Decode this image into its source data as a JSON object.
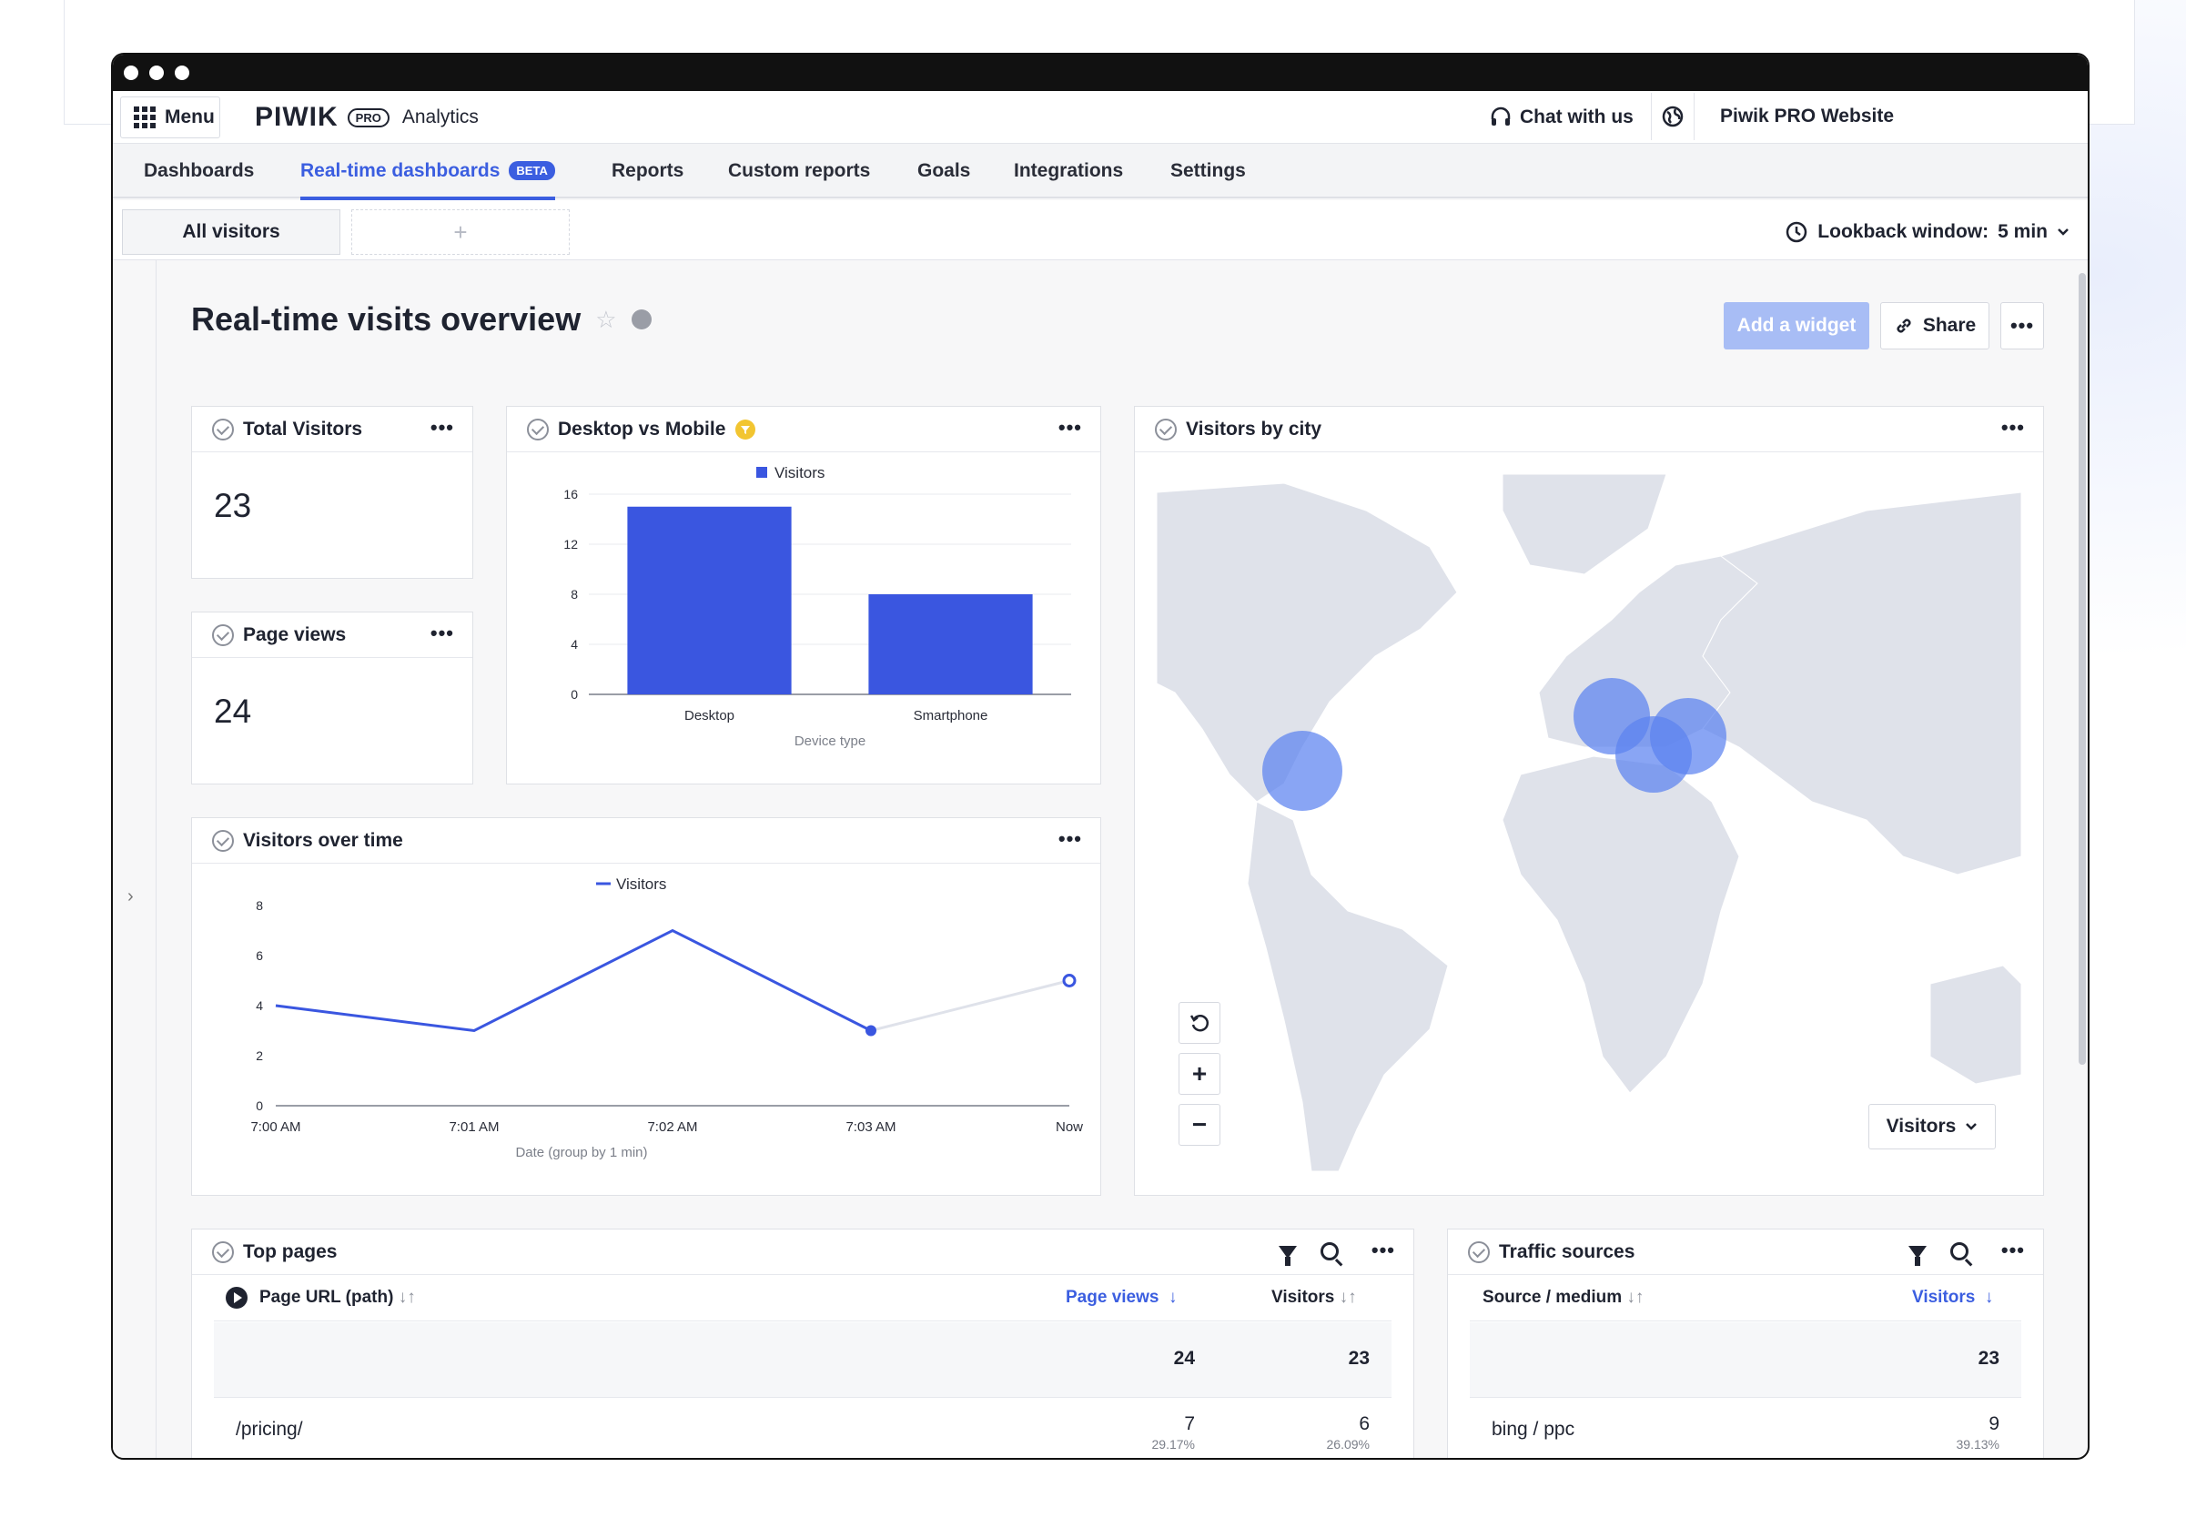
{
  "app": {
    "menu_label": "Menu",
    "logo_text": "PIWIK",
    "logo_badge": "PRO",
    "product": "Analytics",
    "chat_label": "Chat with us",
    "site_name": "Piwik PRO Website"
  },
  "nav": {
    "items": [
      {
        "label": "Dashboards"
      },
      {
        "label": "Real-time dashboards",
        "badge": "BETA",
        "active": true
      },
      {
        "label": "Reports"
      },
      {
        "label": "Custom reports"
      },
      {
        "label": "Goals"
      },
      {
        "label": "Integrations"
      },
      {
        "label": "Settings"
      }
    ]
  },
  "subbar": {
    "tab_label": "All visitors",
    "add_tab": "+",
    "lookback_label": "Lookback window:",
    "lookback_value": "5 min"
  },
  "page": {
    "title": "Real-time visits overview",
    "add_widget": "Add a widget",
    "share": "Share"
  },
  "widgets": {
    "total_visitors": {
      "title": "Total Visitors",
      "value": "23"
    },
    "page_views": {
      "title": "Page views",
      "value": "24"
    },
    "desktop_mobile": {
      "title": "Desktop vs Mobile"
    },
    "visitors_over_time": {
      "title": "Visitors over time"
    },
    "visitors_by_city": {
      "title": "Visitors by city",
      "metric_select": "Visitors"
    },
    "top_pages": {
      "title": "Top pages",
      "col_url": "Page URL (path)",
      "col_pageviews": "Page views",
      "col_visitors": "Visitors",
      "total_pageviews": "24",
      "total_visitors": "23",
      "rows": [
        {
          "url": "/pricing/",
          "pageviews": "7",
          "pageviews_pct": "29.17%",
          "visitors": "6",
          "visitors_pct": "26.09%"
        }
      ]
    },
    "traffic_sources": {
      "title": "Traffic sources",
      "col_source": "Source / medium",
      "col_visitors": "Visitors",
      "total_visitors": "23",
      "rows": [
        {
          "source": "bing / ppc",
          "visitors": "9",
          "visitors_pct": "39.13%"
        }
      ]
    }
  },
  "colors": {
    "accent": "#3b5ee0",
    "bar": "#3a56e0",
    "bubble": "#5b82f0",
    "map_land": "#ffffff",
    "map_sea": "#e3e6ee"
  },
  "chart_data": [
    {
      "type": "bar",
      "legend": [
        "Visitors"
      ],
      "categories": [
        "Desktop",
        "Smartphone"
      ],
      "values": [
        15,
        8
      ],
      "xlabel": "Device type",
      "ylabel": "",
      "ylim": [
        0,
        16
      ],
      "yticks": [
        0,
        4,
        8,
        12,
        16
      ]
    },
    {
      "type": "line",
      "legend": [
        "Visitors"
      ],
      "x": [
        "7:00 AM",
        "7:01 AM",
        "7:02 AM",
        "7:03 AM",
        "Now"
      ],
      "values": [
        4,
        3,
        7,
        3,
        5
      ],
      "xlabel": "Date (group by 1 min)",
      "ylabel": "",
      "ylim": [
        0,
        8
      ],
      "yticks": [
        0,
        2,
        4,
        6,
        8
      ]
    }
  ]
}
